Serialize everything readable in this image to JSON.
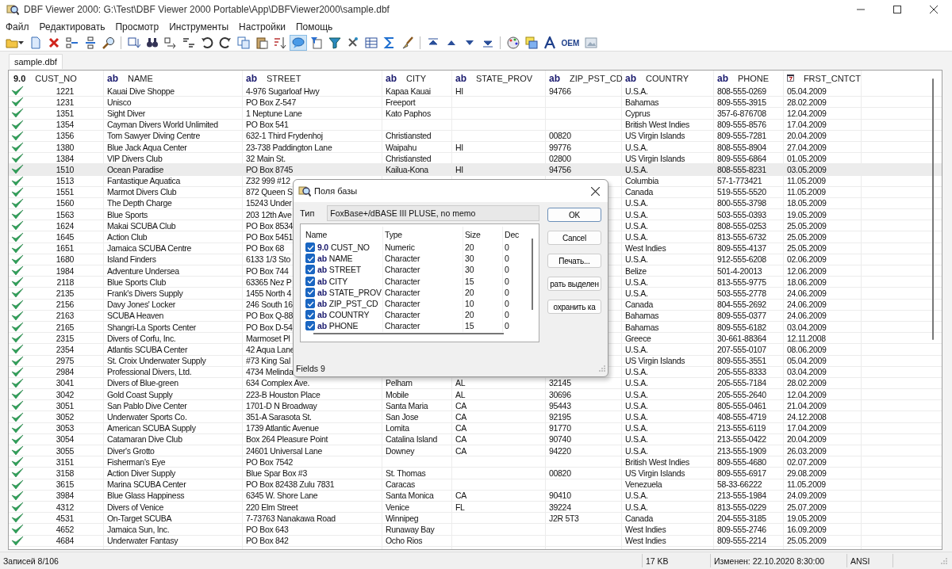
{
  "window": {
    "title": "DBF Viewer 2000: G:\\Test\\DBF Viewer 2000 Portable\\App\\DBFViewer2000\\sample.dbf"
  },
  "menu": [
    "Файл",
    "Редактировать",
    "Просмотр",
    "Инструменты",
    "Настройки",
    "Помощь"
  ],
  "toolbar": [
    {
      "kind": "icon",
      "pressed": false
    },
    {
      "kind": "icon",
      "pressed": false
    },
    {
      "kind": "icon",
      "pressed": false
    },
    {
      "kind": "icon",
      "pressed": false
    },
    {
      "kind": "icon",
      "pressed": false
    },
    {
      "kind": "icon",
      "pressed": false
    },
    {
      "kind": "separator"
    },
    {
      "kind": "icon",
      "pressed": false
    },
    {
      "kind": "icon",
      "pressed": false
    },
    {
      "kind": "icon",
      "pressed": false
    },
    {
      "kind": "icon",
      "pressed": false
    },
    {
      "kind": "icon",
      "pressed": false
    },
    {
      "kind": "icon",
      "pressed": false
    },
    {
      "kind": "icon",
      "pressed": false
    },
    {
      "kind": "icon",
      "pressed": false
    },
    {
      "kind": "icon",
      "pressed": false
    },
    {
      "kind": "icon",
      "pressed": true
    },
    {
      "kind": "icon",
      "pressed": false
    },
    {
      "kind": "icon",
      "pressed": false
    },
    {
      "kind": "icon",
      "pressed": false
    },
    {
      "kind": "icon",
      "pressed": false
    },
    {
      "kind": "icon",
      "pressed": false
    },
    {
      "kind": "icon",
      "pressed": false
    },
    {
      "kind": "separator"
    },
    {
      "kind": "icon",
      "pressed": false
    },
    {
      "kind": "icon",
      "pressed": false
    },
    {
      "kind": "icon",
      "pressed": false
    },
    {
      "kind": "icon",
      "pressed": false
    },
    {
      "kind": "separator"
    },
    {
      "kind": "icon",
      "pressed": false
    },
    {
      "kind": "icon",
      "pressed": false
    },
    {
      "kind": "icon",
      "pressed": false
    },
    {
      "kind": "text",
      "label": "OEM",
      "pressed": false
    },
    {
      "kind": "icon",
      "pressed": false
    }
  ],
  "tabs": [
    {
      "label": "sample.dbf",
      "selected": true
    }
  ],
  "table": {
    "columns": [
      {
        "kind": "numeric",
        "type_label": "9.0",
        "name": "CUST_NO"
      },
      {
        "kind": "character",
        "type_label": "ab",
        "name": "NAME"
      },
      {
        "kind": "character",
        "type_label": "ab",
        "name": "STREET"
      },
      {
        "kind": "character",
        "type_label": "ab",
        "name": "CITY"
      },
      {
        "kind": "character",
        "type_label": "ab",
        "name": "STATE_PROV"
      },
      {
        "kind": "character",
        "type_label": "ab",
        "name": "ZIP_PST_CD"
      },
      {
        "kind": "character",
        "type_label": "ab",
        "name": "COUNTRY"
      },
      {
        "kind": "character",
        "type_label": "ab",
        "name": "PHONE"
      },
      {
        "kind": "date",
        "name": "FRST_CNTCT"
      }
    ],
    "rows": [
      {
        "marked": true,
        "selected": false,
        "cells": [
          "1221",
          "Kauai Dive Shoppe",
          "4-976 Sugarloaf Hwy",
          "Kapaa Kauai",
          "HI",
          "94766",
          "U.S.A.",
          "808-555-0269",
          "05.04.2009"
        ]
      },
      {
        "marked": true,
        "selected": false,
        "cells": [
          "1231",
          "Unisco",
          "PO Box Z-547",
          "Freeport",
          null,
          null,
          "Bahamas",
          "809-555-3915",
          "28.02.2009"
        ]
      },
      {
        "marked": true,
        "selected": false,
        "cells": [
          "1351",
          "Sight Diver",
          "1 Neptune Lane",
          "Kato Paphos",
          null,
          null,
          "Cyprus",
          "357-6-876708",
          "12.04.2009"
        ]
      },
      {
        "marked": true,
        "selected": false,
        "cells": [
          "1354",
          "Cayman Divers World Unlimited",
          "PO Box 541",
          null,
          null,
          null,
          "British West Indies",
          "809-555-8576",
          "17.04.2009"
        ]
      },
      {
        "marked": true,
        "selected": false,
        "cells": [
          "1356",
          "Tom Sawyer Diving Centre",
          "632-1 Third Frydenhoj",
          "Christiansted",
          null,
          "00820",
          "US Virgin Islands",
          "809-555-7281",
          "20.04.2009"
        ]
      },
      {
        "marked": true,
        "selected": false,
        "cells": [
          "1380",
          "Blue Jack Aqua Center",
          "23-738 Paddington Lane",
          "Waipahu",
          "HI",
          "99776",
          "U.S.A.",
          "808-555-8904",
          "27.04.2009"
        ]
      },
      {
        "marked": true,
        "selected": false,
        "cells": [
          "1384",
          "VIP Divers Club",
          "32 Main St.",
          "Christiansted",
          null,
          "02800",
          "US Virgin Islands",
          "809-555-6864",
          "01.05.2009"
        ]
      },
      {
        "marked": true,
        "selected": true,
        "cells": [
          "1510",
          "Ocean Paradise",
          "PO Box 8745",
          "Kailua-Kona",
          "HI",
          "94756",
          "U.S.A.",
          "808-555-8231",
          "03.05.2009"
        ]
      },
      {
        "marked": true,
        "selected": false,
        "cells": [
          "1513",
          "Fantastique Aquatica",
          "Z32 999 #12",
          null,
          null,
          null,
          "Columbia",
          "57-1-773421",
          "11.05.2009"
        ]
      },
      {
        "marked": true,
        "selected": false,
        "cells": [
          "1551",
          "Marmot Divers Club",
          "872 Queen S",
          null,
          null,
          null,
          "Canada",
          "519-555-5520",
          "11.05.2009"
        ]
      },
      {
        "marked": true,
        "selected": false,
        "cells": [
          "1560",
          "The Depth Charge",
          "15243 Under",
          null,
          null,
          null,
          "U.S.A.",
          "800-555-3798",
          "18.05.2009"
        ]
      },
      {
        "marked": true,
        "selected": false,
        "cells": [
          "1563",
          "Blue Sports",
          "203 12th Ave",
          null,
          null,
          null,
          "U.S.A.",
          "503-555-0393",
          "19.05.2009"
        ]
      },
      {
        "marked": true,
        "selected": false,
        "cells": [
          "1624",
          "Makai SCUBA Club",
          "PO Box 8534",
          null,
          null,
          null,
          "U.S.A.",
          "808-555-0253",
          "25.05.2009"
        ]
      },
      {
        "marked": true,
        "selected": false,
        "cells": [
          "1645",
          "Action Club",
          "PO Box 5451",
          null,
          null,
          null,
          "U.S.A.",
          "813-555-6732",
          "25.05.2009"
        ]
      },
      {
        "marked": true,
        "selected": false,
        "cells": [
          "1651",
          "Jamaica SCUBA Centre",
          "PO Box 68",
          null,
          null,
          null,
          "West Indies",
          "809-555-4137",
          "25.05.2009"
        ]
      },
      {
        "marked": true,
        "selected": false,
        "cells": [
          "1680",
          "Island Finders",
          "6133 1/3 Sto",
          null,
          null,
          null,
          "U.S.A.",
          "912-555-6208",
          "02.06.2009"
        ]
      },
      {
        "marked": true,
        "selected": false,
        "cells": [
          "1984",
          "Adventure Undersea",
          "PO Box 744",
          null,
          null,
          null,
          "Belize",
          "501-4-20013",
          "12.06.2009"
        ]
      },
      {
        "marked": true,
        "selected": false,
        "cells": [
          "2118",
          "Blue Sports Club",
          "63365 Nez P",
          null,
          null,
          null,
          "U.S.A.",
          "813-555-9775",
          "18.06.2009"
        ]
      },
      {
        "marked": true,
        "selected": false,
        "cells": [
          "2135",
          "Frank's Divers Supply",
          "1455 North 4",
          null,
          null,
          null,
          "U.S.A.",
          "503-555-2778",
          "24.06.2009"
        ]
      },
      {
        "marked": true,
        "selected": false,
        "cells": [
          "2156",
          "Davy Jones' Locker",
          "246 South 16",
          null,
          null,
          null,
          "Canada",
          "804-555-2692",
          "24.06.2009"
        ]
      },
      {
        "marked": true,
        "selected": false,
        "cells": [
          "2163",
          "SCUBA Heaven",
          "PO Box Q-88",
          null,
          null,
          null,
          "Bahamas",
          "809-555-0377",
          "24.06.2009"
        ]
      },
      {
        "marked": true,
        "selected": false,
        "cells": [
          "2165",
          "Shangri-La Sports Center",
          "PO Box D-54",
          null,
          null,
          null,
          "Bahamas",
          "809-555-6182",
          "03.04.2009"
        ]
      },
      {
        "marked": true,
        "selected": false,
        "cells": [
          "2315",
          "Divers of Corfu, Inc.",
          "Marmoset Pl",
          null,
          null,
          null,
          "Greece",
          "30-661-88364",
          "12.11.2008"
        ]
      },
      {
        "marked": true,
        "selected": false,
        "cells": [
          "2354",
          "Atlantis SCUBA Center",
          "42 Aqua Lane",
          null,
          null,
          null,
          "U.S.A.",
          "207-555-0107",
          "08.06.2009"
        ]
      },
      {
        "marked": true,
        "selected": false,
        "cells": [
          "2975",
          "St. Croix Underwater Supply",
          "#73 King Sal",
          null,
          null,
          null,
          "US Virgin Islands",
          "809-555-3551",
          "05.04.2009"
        ]
      },
      {
        "marked": true,
        "selected": false,
        "cells": [
          "2984",
          "Professional Divers, Ltd.",
          "4734 Melinda",
          null,
          null,
          null,
          "U.S.A.",
          "205-555-8333",
          "03.04.2009"
        ]
      },
      {
        "marked": true,
        "selected": false,
        "cells": [
          "3041",
          "Divers of Blue-green",
          "634 Complex Ave.",
          "Pelham",
          "AL",
          "32145",
          "U.S.A.",
          "205-555-7184",
          "28.02.2009"
        ]
      },
      {
        "marked": true,
        "selected": false,
        "cells": [
          "3042",
          "Gold Coast Supply",
          "223-B Houston Place",
          "Mobile",
          "AL",
          "30696",
          "U.S.A.",
          "205-555-2640",
          "12.04.2009"
        ]
      },
      {
        "marked": true,
        "selected": false,
        "cells": [
          "3051",
          "San Pablo Dive Center",
          "1701-D N Broadway",
          "Santa Maria",
          "CA",
          "95443",
          "U.S.A.",
          "805-555-0461",
          "21.04.2009"
        ]
      },
      {
        "marked": true,
        "selected": false,
        "cells": [
          "3052",
          "Underwater Sports Co.",
          "351-A Sarasota St.",
          "San Jose",
          "CA",
          "92195",
          "U.S.A.",
          "408-555-4719",
          "24.12.2008"
        ]
      },
      {
        "marked": true,
        "selected": false,
        "cells": [
          "3053",
          "American SCUBA Supply",
          "1739 Atlantic Avenue",
          "Lomita",
          "CA",
          "91770",
          "U.S.A.",
          "213-555-6119",
          "17.04.2009"
        ]
      },
      {
        "marked": true,
        "selected": false,
        "cells": [
          "3054",
          "Catamaran Dive Club",
          "Box 264 Pleasure Point",
          "Catalina Island",
          "CA",
          "90740",
          "U.S.A.",
          "213-555-0422",
          "20.04.2009"
        ]
      },
      {
        "marked": true,
        "selected": false,
        "cells": [
          "3055",
          "Diver's Grotto",
          "24601 Universal Lane",
          "Downey",
          "CA",
          "94220",
          "U.S.A.",
          "213-555-1909",
          "26.03.2009"
        ]
      },
      {
        "marked": true,
        "selected": false,
        "cells": [
          "3151",
          "Fisherman's Eye",
          "PO Box 7542",
          null,
          null,
          null,
          "British West Indies",
          "809-555-4680",
          "02.07.2009"
        ]
      },
      {
        "marked": true,
        "selected": false,
        "cells": [
          "3158",
          "Action Diver Supply",
          "Blue Spar Box #3",
          "St. Thomas",
          null,
          "00820",
          "US Virgin Islands",
          "809-555-6917",
          "29.08.2009"
        ]
      },
      {
        "marked": true,
        "selected": false,
        "cells": [
          "3615",
          "Marina SCUBA Center",
          "PO Box 82438 Zulu 7831",
          "Caracas",
          null,
          null,
          "Venezuela",
          "58-33-66222",
          "11.05.2009"
        ]
      },
      {
        "marked": true,
        "selected": false,
        "cells": [
          "3984",
          "Blue Glass Happiness",
          "6345 W. Shore Lane",
          "Santa Monica",
          "CA",
          "90410",
          "U.S.A.",
          "213-555-1984",
          "24.09.2009"
        ]
      },
      {
        "marked": true,
        "selected": false,
        "cells": [
          "4312",
          "Divers of Venice",
          "220 Elm Street",
          "Venice",
          "FL",
          "39224",
          "U.S.A.",
          "813-555-0229",
          "25.07.2009"
        ]
      },
      {
        "marked": true,
        "selected": false,
        "cells": [
          "4531",
          "On-Target SCUBA",
          "7-73763 Nanakawa Road",
          "Winnipeg",
          null,
          "J2R 5T3",
          "Canada",
          "204-555-3185",
          "19.05.2009"
        ]
      },
      {
        "marked": true,
        "selected": false,
        "cells": [
          "4652",
          "Jamaica Sun, Inc.",
          "PO Box 643",
          "Runaway Bay",
          null,
          null,
          "West Indies",
          "809-555-2746",
          "16.09.2009"
        ]
      },
      {
        "marked": true,
        "selected": false,
        "cells": [
          "4684",
          "Underwater Fantasy",
          "PO Box 842",
          "Ocho Rios",
          null,
          null,
          "West Indies",
          "809-555-2214",
          "25.05.2009"
        ]
      }
    ]
  },
  "dialog": {
    "title": "Поля базы",
    "type_label": "Тип",
    "type_value": "FoxBase+/dBASE III PLUSE, no memo",
    "list_columns": [
      "Name",
      "Type",
      "Size",
      "Dec"
    ],
    "fields": [
      {
        "checked": true,
        "type_label": "9.0",
        "name": "CUST_NO",
        "type": "Numeric",
        "size": "20",
        "dec": "0"
      },
      {
        "checked": true,
        "type_label": "ab",
        "name": "NAME",
        "type": "Character",
        "size": "30",
        "dec": "0"
      },
      {
        "checked": true,
        "type_label": "ab",
        "name": "STREET",
        "type": "Character",
        "size": "30",
        "dec": "0"
      },
      {
        "checked": true,
        "type_label": "ab",
        "name": "CITY",
        "type": "Character",
        "size": "15",
        "dec": "0"
      },
      {
        "checked": true,
        "type_label": "ab",
        "name": "STATE_PROV",
        "type": "Character",
        "size": "20",
        "dec": "0"
      },
      {
        "checked": true,
        "type_label": "ab",
        "name": "ZIP_PST_CD",
        "type": "Character",
        "size": "10",
        "dec": "0"
      },
      {
        "checked": true,
        "type_label": "ab",
        "name": "COUNTRY",
        "type": "Character",
        "size": "20",
        "dec": "0"
      },
      {
        "checked": true,
        "type_label": "ab",
        "name": "PHONE",
        "type": "Character",
        "size": "15",
        "dec": "0"
      }
    ],
    "buttons": [
      {
        "label": "OK",
        "default": true
      },
      {
        "label": "Cancel",
        "default": false
      },
      {
        "label": "Печать...",
        "default": false
      },
      {
        "label": "рать выделен",
        "default": false
      },
      {
        "label": "охранить ка",
        "default": false
      }
    ],
    "footer": "Fields 9"
  },
  "status_bar": [
    "Записей 8/106",
    "17 KB",
    "Изменен: 22.10.2020 8:30:00",
    "ANSI"
  ]
}
